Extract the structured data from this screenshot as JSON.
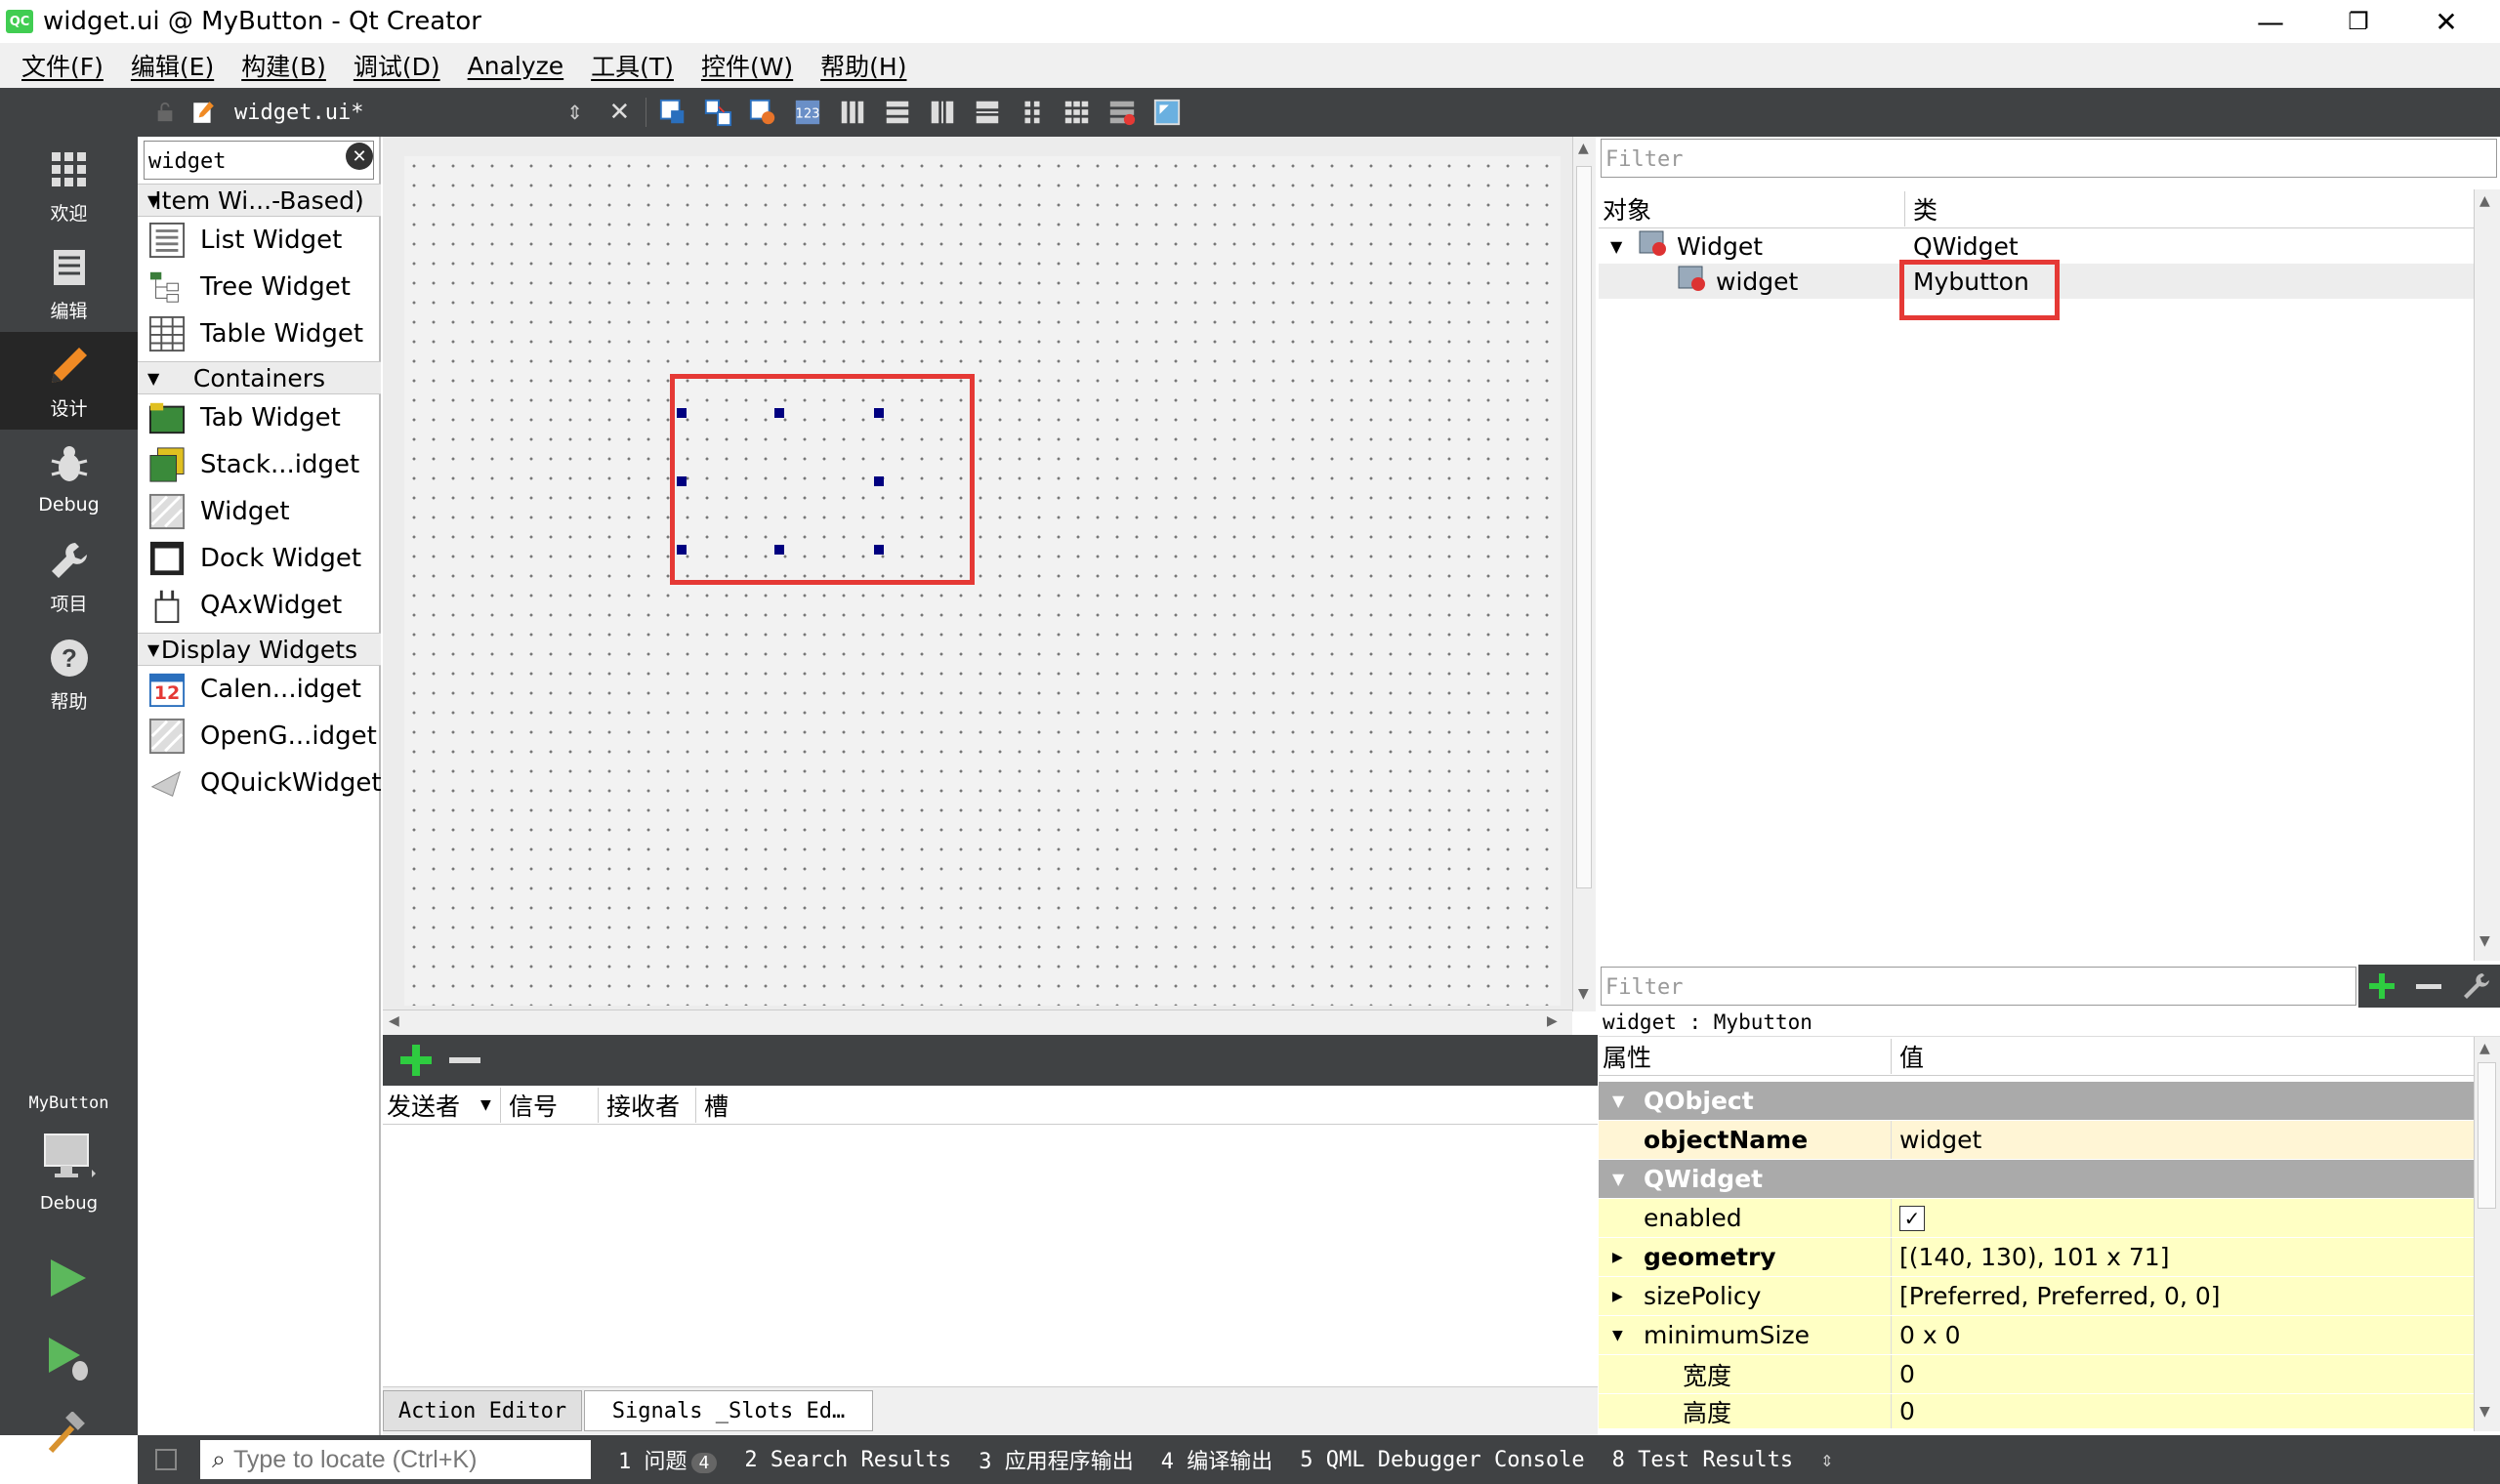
{
  "window": {
    "title": "widget.ui @ MyButton - Qt Creator",
    "app_icon": "QC",
    "minimize": "—",
    "maximize": "❐",
    "close": "✕"
  },
  "menu": [
    "文件(F)",
    "编辑(E)",
    "构建(B)",
    "调试(D)",
    "Analyze",
    "工具(T)",
    "控件(W)",
    "帮助(H)"
  ],
  "modes": [
    {
      "label": "欢迎",
      "icon": "grid-icon"
    },
    {
      "label": "编辑",
      "icon": "document-icon"
    },
    {
      "label": "设计",
      "icon": "pencil-icon"
    },
    {
      "label": "Debug",
      "icon": "bug-icon"
    },
    {
      "label": "项目",
      "icon": "wrench-icon"
    },
    {
      "label": "帮助",
      "icon": "help-icon"
    }
  ],
  "kit": {
    "project": "MyButton",
    "config": "Debug"
  },
  "editor": {
    "filename": "widget.ui*"
  },
  "widgetbox": {
    "filter": "widget",
    "categories": [
      "Item Wi...-Based)",
      "Containers",
      "Display Widgets"
    ],
    "items_itemviews": [
      "List Widget",
      "Tree Widget",
      "Table Widget"
    ],
    "items_containers": [
      "Tab Widget",
      "Stack...idget",
      "Widget",
      "Dock Widget",
      "QAxWidget"
    ],
    "items_display": [
      "Calen...idget",
      "OpenG...idget",
      "QQuickWidget"
    ],
    "calendar_day": "12"
  },
  "signals": {
    "columns": [
      "发送者",
      "信号",
      "接收者",
      "槽"
    ],
    "tabs": [
      "Action Editor",
      "Signals _Slots Ed…"
    ]
  },
  "object_inspector": {
    "filter_placeholder": "Filter",
    "columns": [
      "对象",
      "类"
    ],
    "rows": [
      {
        "object": "Widget",
        "class": "QWidget"
      },
      {
        "object": "widget",
        "class": "Mybutton"
      }
    ]
  },
  "property_editor": {
    "filter_placeholder": "Filter",
    "context": "widget : Mybutton",
    "columns": [
      "属性",
      "值"
    ],
    "groups": [
      "QObject",
      "QWidget"
    ],
    "objectName": {
      "name": "objectName",
      "value": "widget"
    },
    "props": [
      {
        "name": "enabled",
        "value": "✓"
      },
      {
        "name": "geometry",
        "value": "[(140, 130), 101 x 71]"
      },
      {
        "name": "sizePolicy",
        "value": "[Preferred, Preferred, 0, 0]"
      },
      {
        "name": "minimumSize",
        "value": "0 x 0"
      },
      {
        "name": "宽度",
        "value": "0"
      },
      {
        "name": "高度",
        "value": "0"
      }
    ]
  },
  "statusbar": {
    "locate_placeholder": "Type to locate (Ctrl+K)",
    "tabs": [
      "1 问题",
      "2 Search Results",
      "3 应用程序输出",
      "4 编译输出",
      "5 QML Debugger Console",
      "8 Test Results"
    ],
    "issues_count": "4"
  },
  "colors": {
    "sidebar": "#404244",
    "highlight": "#e53935",
    "handle": "#000080"
  }
}
